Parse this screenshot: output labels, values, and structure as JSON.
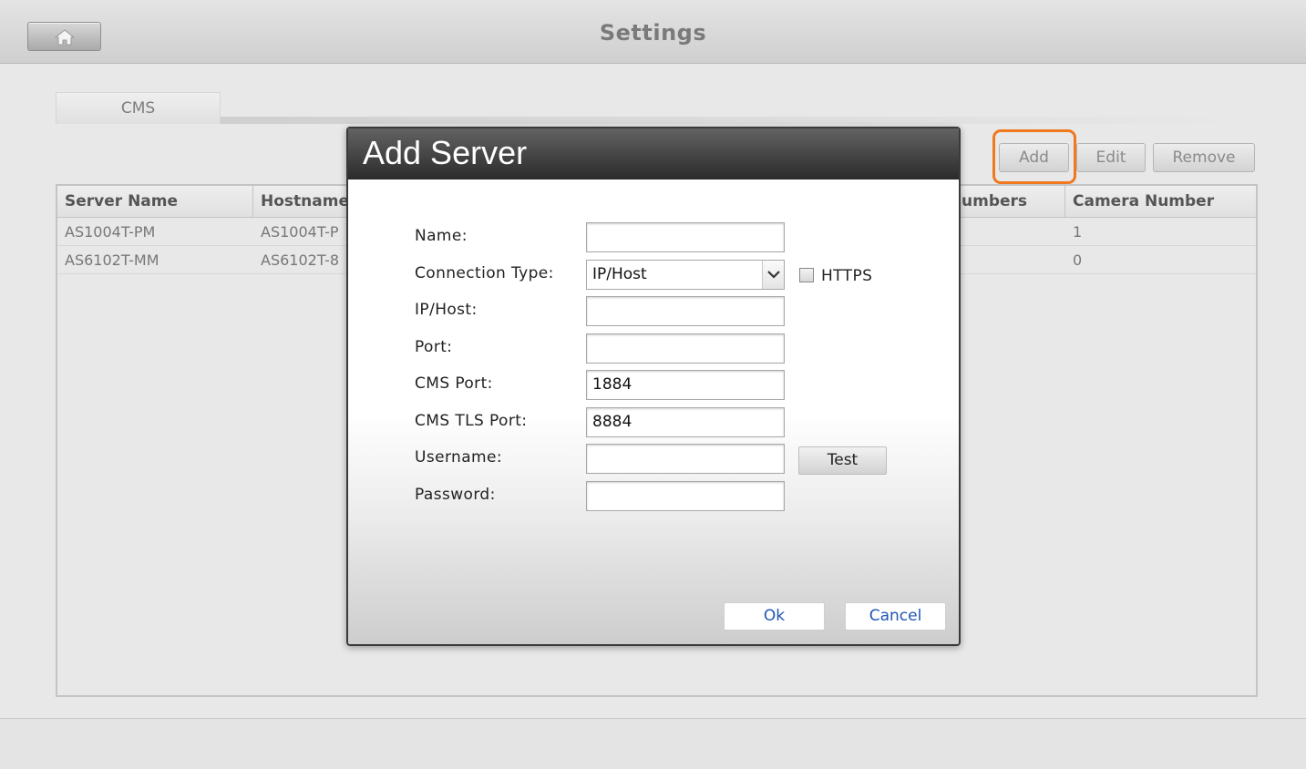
{
  "header": {
    "title": "Settings",
    "home_icon": "home-icon"
  },
  "tabs": [
    {
      "label": "CMS"
    }
  ],
  "toolbar": {
    "add_label": "Add",
    "edit_label": "Edit",
    "remove_label": "Remove"
  },
  "table": {
    "columns": [
      "Server Name",
      "Hostname",
      "umbers",
      "Camera Number"
    ],
    "rows": [
      {
        "server_name": "AS1004T-PM",
        "hostname": "AS1004T-P",
        "camera_number": "1"
      },
      {
        "server_name": "AS6102T-MM",
        "hostname": "AS6102T-8",
        "camera_number": "0"
      }
    ]
  },
  "dialog": {
    "title": "Add Server",
    "fields": {
      "name_label": "Name:",
      "name_value": "",
      "connection_type_label": "Connection Type:",
      "connection_type_value": "IP/Host",
      "https_label": "HTTPS",
      "ip_host_label": "IP/Host:",
      "ip_host_value": "",
      "port_label": "Port:",
      "port_value": "",
      "cms_port_label": "CMS Port:",
      "cms_port_value": "1884",
      "cms_tls_port_label": "CMS TLS Port:",
      "cms_tls_port_value": "8884",
      "username_label": "Username:",
      "username_value": "",
      "password_label": "Password:",
      "password_value": ""
    },
    "test_label": "Test",
    "ok_label": "Ok",
    "cancel_label": "Cancel"
  },
  "colors": {
    "highlight": "#f0781e",
    "dialog_button_text": "#1f55b5"
  }
}
